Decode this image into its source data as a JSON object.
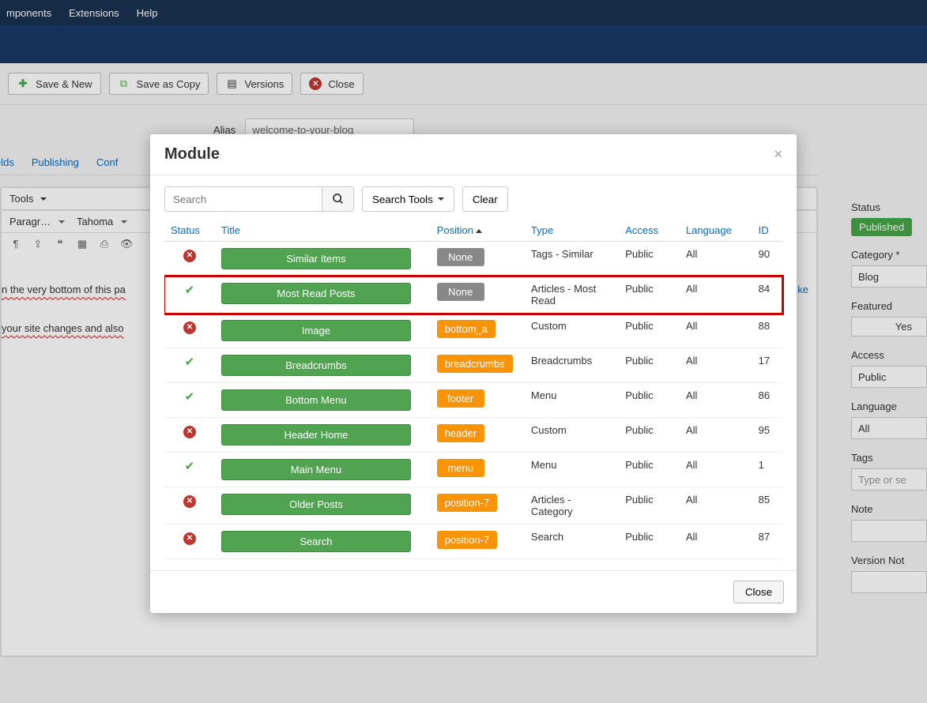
{
  "topnav": {
    "components": "mponents",
    "extensions": "Extensions",
    "help": "Help"
  },
  "toolbar": {
    "saveNew": "Save & New",
    "saveCopy": "Save as Copy",
    "versions": "Versions",
    "close": "Close"
  },
  "bg": {
    "aliasLabel": "Alias",
    "aliasValue": "welcome-to-your-blog",
    "tab1": "elds",
    "tab2": "Publishing",
    "tab3": "Conf",
    "tools": "Tools",
    "styleSel": "Paragr…",
    "fontSel": "Tahoma",
    "line1a": "n the very bottom of this pa",
    "line1b": "ke",
    "line2a": "your site changes and ",
    "line2b": "also"
  },
  "side": {
    "statusLabel": "Status",
    "statusVal": "Published",
    "catLabel": "Category *",
    "catVal": "Blog",
    "featLabel": "Featured",
    "featVal": "Yes",
    "accLabel": "Access",
    "accVal": "Public",
    "langLabel": "Language",
    "langVal": "All",
    "tagsLabel": "Tags",
    "tagsPlaceholder": "Type or se",
    "noteLabel": "Note",
    "vnoteLabel": "Version Not"
  },
  "modal": {
    "title": "Module",
    "searchPlaceholder": "Search",
    "searchTools": "Search Tools",
    "clear": "Clear",
    "closeBtn": "Close",
    "cols": {
      "status": "Status",
      "title": "Title",
      "position": "Position",
      "type": "Type",
      "access": "Access",
      "language": "Language",
      "id": "ID"
    },
    "rows": [
      {
        "status": "x",
        "title": "Similar Items",
        "position": "None",
        "posStyle": "none",
        "type": "Tags - Similar",
        "access": "Public",
        "lang": "All",
        "id": "90",
        "hl": false
      },
      {
        "status": "ok",
        "title": "Most Read Posts",
        "position": "None",
        "posStyle": "none",
        "type": "Articles - Most Read",
        "access": "Public",
        "lang": "All",
        "id": "84",
        "hl": true
      },
      {
        "status": "x",
        "title": "Image",
        "position": "bottom_a",
        "posStyle": "orange",
        "type": "Custom",
        "access": "Public",
        "lang": "All",
        "id": "88",
        "hl": false
      },
      {
        "status": "ok",
        "title": "Breadcrumbs",
        "position": "breadcrumbs",
        "posStyle": "orange",
        "type": "Breadcrumbs",
        "access": "Public",
        "lang": "All",
        "id": "17",
        "hl": false
      },
      {
        "status": "ok",
        "title": "Bottom Menu",
        "position": "footer",
        "posStyle": "orange",
        "type": "Menu",
        "access": "Public",
        "lang": "All",
        "id": "86",
        "hl": false
      },
      {
        "status": "x",
        "title": "Header Home",
        "position": "header",
        "posStyle": "orange",
        "type": "Custom",
        "access": "Public",
        "lang": "All",
        "id": "95",
        "hl": false
      },
      {
        "status": "ok",
        "title": "Main Menu",
        "position": "menu",
        "posStyle": "orange",
        "type": "Menu",
        "access": "Public",
        "lang": "All",
        "id": "1",
        "hl": false
      },
      {
        "status": "x",
        "title": "Older Posts",
        "position": "position-7",
        "posStyle": "orange",
        "type": "Articles - Category",
        "access": "Public",
        "lang": "All",
        "id": "85",
        "hl": false
      },
      {
        "status": "x",
        "title": "Search",
        "position": "position-7",
        "posStyle": "orange",
        "type": "Search",
        "access": "Public",
        "lang": "All",
        "id": "87",
        "hl": false
      }
    ]
  }
}
